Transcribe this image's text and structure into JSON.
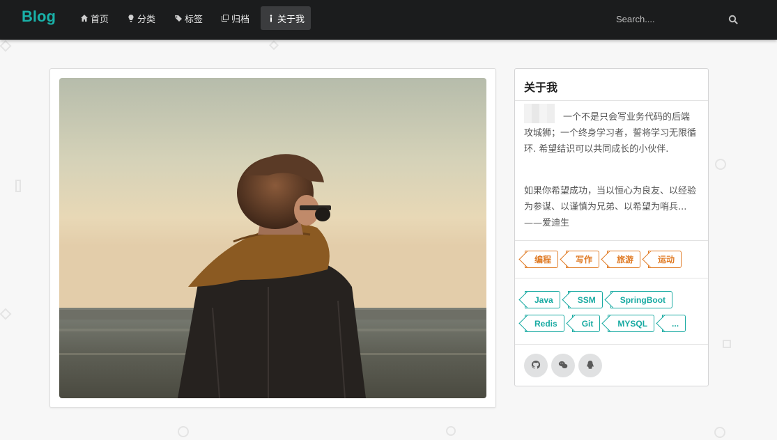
{
  "brand": "Blog",
  "nav": [
    {
      "label": "首页",
      "icon": "home-icon"
    },
    {
      "label": "分类",
      "icon": "lightbulb-icon"
    },
    {
      "label": "标签",
      "icon": "tags-icon"
    },
    {
      "label": "归档",
      "icon": "clone-icon"
    },
    {
      "label": "关于我",
      "icon": "info-icon"
    }
  ],
  "search": {
    "placeholder": "Search...."
  },
  "about": {
    "title": "关于我",
    "bio": "一个不是只会写业务代码的后端攻城狮；一个终身学习者，誓将学习无限循环. 希望结识可以共同成长的小伙伴.",
    "quote": "如果你希望成功，当以恒心为良友、以经验为参谋、以谨慎为兄弟、以希望为哨兵...——爱迪生",
    "interests": [
      "编程",
      "写作",
      "旅游",
      "运动"
    ],
    "skills": [
      "Java",
      "SSM",
      "SpringBoot",
      "Redis",
      "Git",
      "MYSQL",
      "..."
    ],
    "social": [
      "github-icon",
      "wechat-icon",
      "qq-icon"
    ]
  },
  "colors": {
    "brand": "#19b1a8",
    "navbar": "#1b1c1d",
    "orange_tag": "#e07b25",
    "teal_tag": "#18aaa2"
  }
}
